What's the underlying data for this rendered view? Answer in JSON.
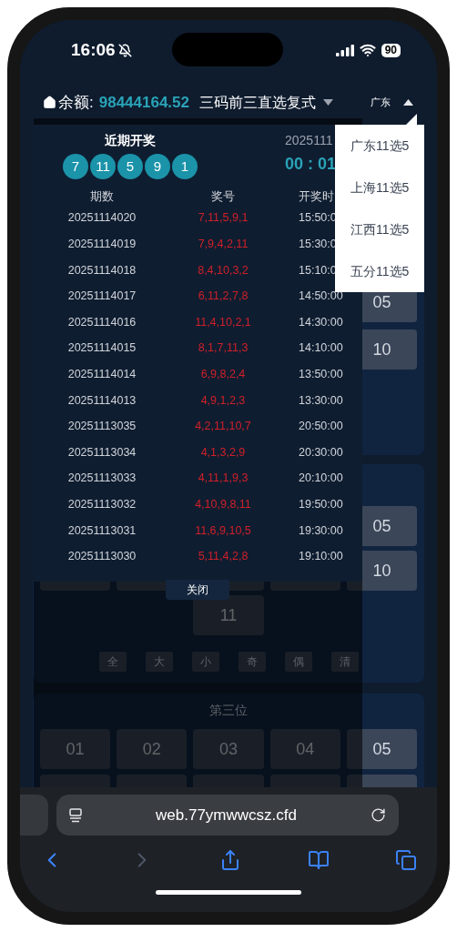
{
  "status_bar": {
    "time": "16:06",
    "silent": true,
    "battery": "90"
  },
  "header": {
    "balance_label": "余额:",
    "balance": "98444164.52",
    "play_type": "三码前三直选复式",
    "region": "广东",
    "region_menu_open": true
  },
  "region_menu": [
    {
      "label": "广东11选5"
    },
    {
      "label": "上海11选5"
    },
    {
      "label": "江西11选5"
    },
    {
      "label": "五分11选5"
    }
  ],
  "recent_draws": {
    "title": "近期开奖",
    "latest_balls": [
      "7",
      "11",
      "5",
      "9",
      "1"
    ],
    "next_issue": "2025111",
    "countdown": "00 : 01",
    "columns": [
      "期数",
      "奖号",
      "开奖时"
    ],
    "rows": [
      {
        "issue": "20251114020",
        "numbers": "7,11,5,9,1",
        "time": "15:50:0"
      },
      {
        "issue": "20251114019",
        "numbers": "7,9,4,2,11",
        "time": "15:30:0"
      },
      {
        "issue": "20251114018",
        "numbers": "8,4,10,3,2",
        "time": "15:10:0"
      },
      {
        "issue": "20251114017",
        "numbers": "6,11,2,7,8",
        "time": "14:50:00"
      },
      {
        "issue": "20251114016",
        "numbers": "11,4,10,2,1",
        "time": "14:30:00"
      },
      {
        "issue": "20251114015",
        "numbers": "8,1,7,11,3",
        "time": "14:10:00"
      },
      {
        "issue": "20251114014",
        "numbers": "6,9,8,2,4",
        "time": "13:50:00"
      },
      {
        "issue": "20251114013",
        "numbers": "4,9,1,2,3",
        "time": "13:30:00"
      },
      {
        "issue": "20251113035",
        "numbers": "4,2,11,10,7",
        "time": "20:50:00"
      },
      {
        "issue": "20251113034",
        "numbers": "4,1,3,2,9",
        "time": "20:30:00"
      },
      {
        "issue": "20251113033",
        "numbers": "4,11,1,9,3",
        "time": "20:10:00"
      },
      {
        "issue": "20251113032",
        "numbers": "4,10,9,8,11",
        "time": "19:50:00"
      },
      {
        "issue": "20251113031",
        "numbers": "11,6,9,10,5",
        "time": "19:30:00"
      },
      {
        "issue": "20251113030",
        "numbers": "5,11,4,2,8",
        "time": "19:10:00"
      }
    ],
    "close_button": "关闭"
  },
  "background": {
    "sections": [
      {
        "right_column": [
          "05",
          "10"
        ]
      },
      {
        "right_column": [
          "05",
          "10"
        ],
        "center": "11",
        "quick_picks": [
          "全",
          "大",
          "小",
          "奇",
          "偶",
          "清"
        ]
      },
      {
        "title": "第三位",
        "numbers": [
          "01",
          "02",
          "03",
          "04",
          "05"
        ]
      }
    ]
  },
  "browser": {
    "url": "web.77ymwwcsz.cfd"
  }
}
